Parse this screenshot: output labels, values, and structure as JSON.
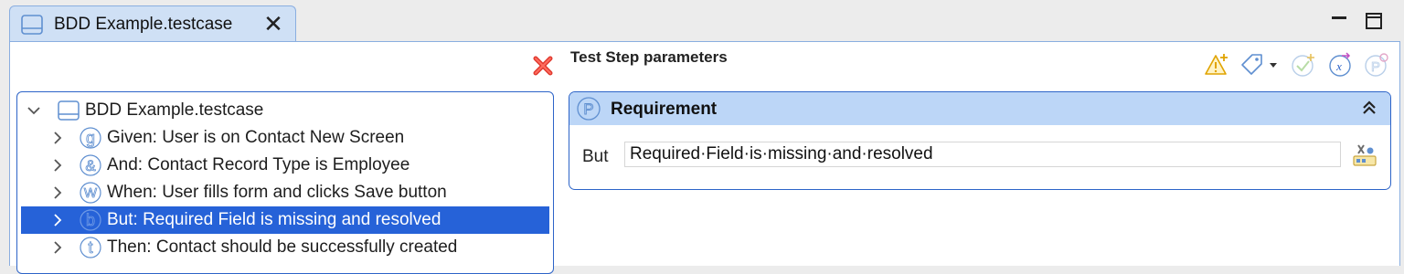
{
  "tab": {
    "title": "BDD Example.testcase",
    "close_glyph": "✕"
  },
  "params": {
    "title": "Test Step parameters",
    "toolbar": [
      "warning-add-icon",
      "tag-dropdown-icon",
      "check-add-icon",
      "variable-icon",
      "parameter-add-icon"
    ]
  },
  "tree": {
    "root": "BDD Example.testcase",
    "items": [
      {
        "letter": "g",
        "label": "Given: User is on Contact New Screen",
        "selected": false
      },
      {
        "letter": "&",
        "label": "And: Contact Record Type is Employee",
        "selected": false
      },
      {
        "letter": "w",
        "label": "When: User fills form and clicks Save button",
        "selected": false
      },
      {
        "letter": "b",
        "label": "But: Required Field is missing and resolved",
        "selected": true
      },
      {
        "letter": "t",
        "label": "Then: Contact should be successfully created",
        "selected": false
      }
    ]
  },
  "section": {
    "title": "Requirement",
    "param_label": "But",
    "param_value": "Required·Field·is·missing·and·resolved"
  },
  "colors": {
    "accent": "#2662d8",
    "section_header": "#bcd6f7",
    "tab_bg": "#cfe0f5"
  }
}
